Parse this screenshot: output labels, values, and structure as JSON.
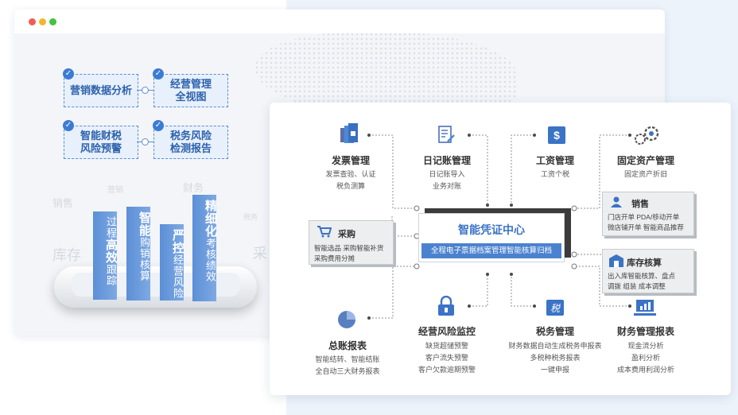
{
  "colors": {
    "blue": "#3b7bd4",
    "dark": "#444444",
    "accent": "#5a8bd0"
  },
  "left_panel": {
    "features": [
      "营销数据分析",
      "经营管理\n全视图",
      "智能财税\n风险预警",
      "税务风险\n检测报告"
    ],
    "ghost_words": [
      "销售",
      "营销",
      "财务",
      "税务",
      "库存",
      "采"
    ],
    "columns": [
      {
        "lines": [
          "过",
          "程",
          "高",
          "效",
          "跟",
          "踪"
        ]
      },
      {
        "lines": [
          "智",
          "能",
          "购",
          "销",
          "核",
          "算"
        ]
      },
      {
        "lines": [
          "严",
          "控",
          "经",
          "营",
          "风",
          "险"
        ]
      },
      {
        "lines": [
          "精",
          "细",
          "化",
          "考",
          "核",
          "绩",
          "效"
        ]
      }
    ]
  },
  "center": {
    "title": "智能凭证中心",
    "subtitle": "全程电子票据档案管理智能核算归档"
  },
  "modules": {
    "invoice": {
      "title": "发票管理",
      "lines": [
        "发票查验、认证",
        "税负测算"
      ]
    },
    "journal": {
      "title": "日记账管理",
      "lines": [
        "日记账导入",
        "业务对账"
      ]
    },
    "salary": {
      "title": "工资管理",
      "lines": [
        "工资个税"
      ]
    },
    "assets": {
      "title": "固定资产管理",
      "lines": [
        "固定资产折旧"
      ]
    },
    "sales": {
      "title": "销售",
      "lines": [
        "门店开单  PDA/移动开单",
        "微店铺开单  智能商品推荐"
      ]
    },
    "purchase": {
      "title": "采购",
      "lines": [
        "智能选品  采购智能补货",
        "采购费用分摊"
      ]
    },
    "inventory": {
      "title": "库存核算",
      "lines": [
        "出入库智能核算、盘点",
        "调拨  组装  成本调整"
      ]
    },
    "ledger": {
      "title": "总账报表",
      "lines": [
        "智能结转、智能结账",
        "全自动三大财务报表"
      ]
    },
    "risk": {
      "title": "经营风险监控",
      "lines": [
        "缺货超储预警",
        "客户流失预警",
        "客户欠款逾期预警"
      ]
    },
    "tax": {
      "title": "税务管理",
      "lines": [
        "财务数据自动生成税务申报表",
        "多税种税务报表",
        "一键申报"
      ]
    },
    "finreport": {
      "title": "财务管理报表",
      "lines": [
        "现金流分析",
        "盈利分析",
        "成本费用利润分析"
      ]
    }
  },
  "icons": [
    "invoice-icon",
    "journal-icon",
    "salary-icon",
    "gear-icon",
    "person-icon",
    "cart-icon",
    "store-icon",
    "pie-chart-icon",
    "lock-icon",
    "tax-icon",
    "monitor-chart-icon",
    "check-icon"
  ]
}
